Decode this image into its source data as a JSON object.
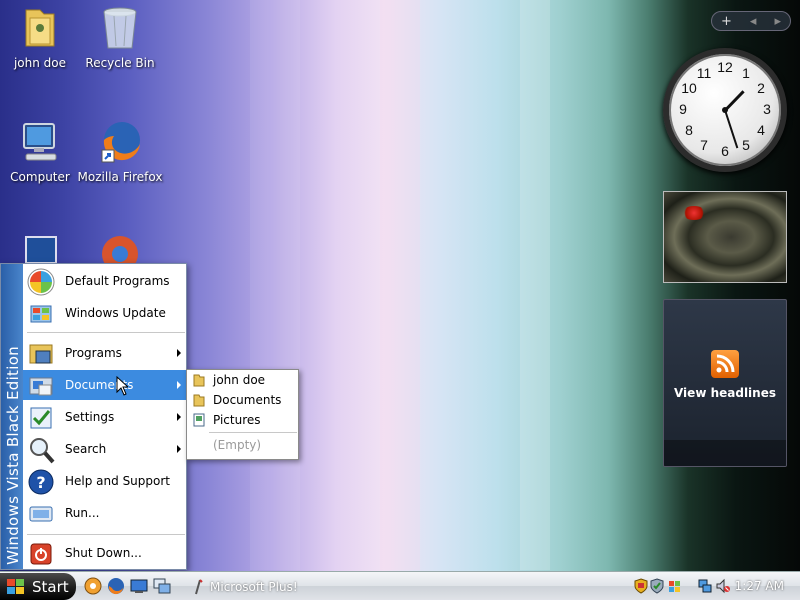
{
  "desktop": {
    "icons": [
      {
        "label": "john doe",
        "icon": "user-folder-icon"
      },
      {
        "label": "Recycle Bin",
        "icon": "recycle-bin-icon"
      },
      {
        "label": "Computer",
        "icon": "computer-icon"
      },
      {
        "label": "Mozilla Firefox",
        "icon": "firefox-icon"
      }
    ]
  },
  "sidebar": {
    "control_add": "+",
    "control_prev": "◂",
    "control_next": "▸",
    "clock_numbers": [
      "12",
      "1",
      "2",
      "3",
      "4",
      "5",
      "6",
      "7",
      "8",
      "9",
      "10",
      "11"
    ],
    "feed_text": "View headlines"
  },
  "start_menu": {
    "side_banner": "Windows Vista Black Edition",
    "items": [
      {
        "label": "Default Programs"
      },
      {
        "label": "Windows Update"
      },
      {
        "label": "Programs"
      },
      {
        "label": "Documents"
      },
      {
        "label": "Settings"
      },
      {
        "label": "Search"
      },
      {
        "label": "Help and Support"
      },
      {
        "label": "Run..."
      },
      {
        "label": "Shut Down..."
      }
    ]
  },
  "documents_submenu": {
    "items": [
      {
        "label": "john doe"
      },
      {
        "label": "Documents"
      },
      {
        "label": "Pictures"
      }
    ],
    "empty_label": "(Empty)"
  },
  "taskbar": {
    "start_label": "Start",
    "task_label": "Microsoft Plus!",
    "time": "1:27 AM"
  },
  "colors": {
    "accent": "#3c8be0",
    "banner": "#2a5fa8"
  }
}
